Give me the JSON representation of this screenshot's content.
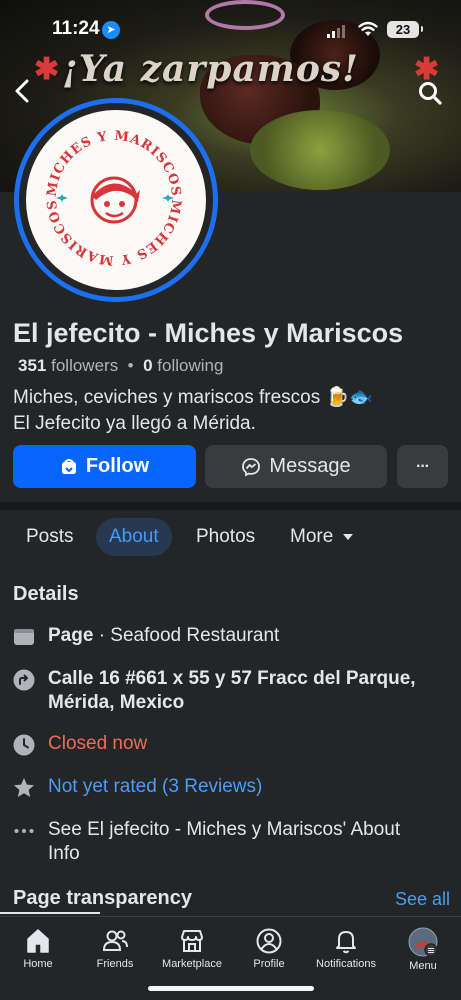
{
  "status_bar": {
    "time": "11:24",
    "battery": "23"
  },
  "cover": {
    "headline": "¡Ya zarpamos!"
  },
  "logo": {
    "top_text": "MICHES Y MARISCOS",
    "bottom_text": "MICHES Y MARISCOS"
  },
  "profile": {
    "name": "El jefecito - Miches y Mariscos",
    "followers_count": "351",
    "followers_label": "followers",
    "separator": "•",
    "following_count": "0",
    "following_label": "following",
    "bio_line1": "Miches, ceviches y mariscos frescos 🍺🐟",
    "bio_line2": "El Jefecito ya llegó a Mérida."
  },
  "actions": {
    "follow": "Follow",
    "message": "Message",
    "more": "···"
  },
  "tabs": [
    {
      "label": "Posts"
    },
    {
      "label": "About"
    },
    {
      "label": "Photos"
    },
    {
      "label": "More"
    }
  ],
  "details": {
    "title": "Details",
    "page_label": "Page",
    "page_category": " · Seafood Restaurant",
    "address_line1": "Calle 16 #661 x 55 y 57 Fracc del Parque,",
    "address_line2": "Mérida, Mexico",
    "hours": "Closed now",
    "rating": "Not yet rated (3 Reviews)",
    "see_about_line1": "See El jefecito - Miches y Mariscos' About",
    "see_about_line2": "Info"
  },
  "transparency": {
    "title": "Page transparency",
    "see_all": "See all"
  },
  "tab_bar": [
    {
      "label": "Home",
      "icon": "home-icon"
    },
    {
      "label": "Friends",
      "icon": "friends-icon"
    },
    {
      "label": "Marketplace",
      "icon": "marketplace-icon"
    },
    {
      "label": "Profile",
      "icon": "profile-icon"
    },
    {
      "label": "Notifications",
      "icon": "bell-icon"
    },
    {
      "label": "Menu",
      "icon": "menu-avatar-icon"
    }
  ],
  "colors": {
    "accent": "#0866ff",
    "link": "#4a9df8",
    "closed": "#f0695a",
    "background": "#242526"
  }
}
